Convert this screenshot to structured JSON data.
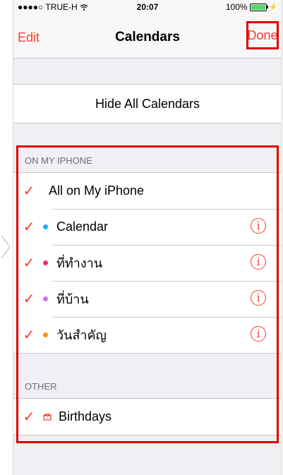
{
  "status_bar": {
    "carrier": "●●●●○ TRUE-H",
    "time": "20:07",
    "battery": "100%"
  },
  "navbar": {
    "edit": "Edit",
    "title": "Calendars",
    "done": "Done"
  },
  "hide_all": "Hide All Calendars",
  "on_my_iphone": {
    "header": "ON MY IPHONE",
    "all_label": "All on My iPhone",
    "items": [
      {
        "label": "Calendar",
        "color": "#1badf8"
      },
      {
        "label": "ที่ทำงาน",
        "color": "#ff2968"
      },
      {
        "label": "ที่บ้าน",
        "color": "#cc73e1"
      },
      {
        "label": "วันสำคัญ",
        "color": "#ff9500"
      }
    ]
  },
  "other": {
    "header": "OTHER",
    "birthdays": "Birthdays"
  },
  "icons": {
    "check": "checkmark-icon",
    "info": "info-icon",
    "gift": "gift-icon",
    "wifi": "wifi-icon"
  },
  "accent_color": "#ff3b30"
}
